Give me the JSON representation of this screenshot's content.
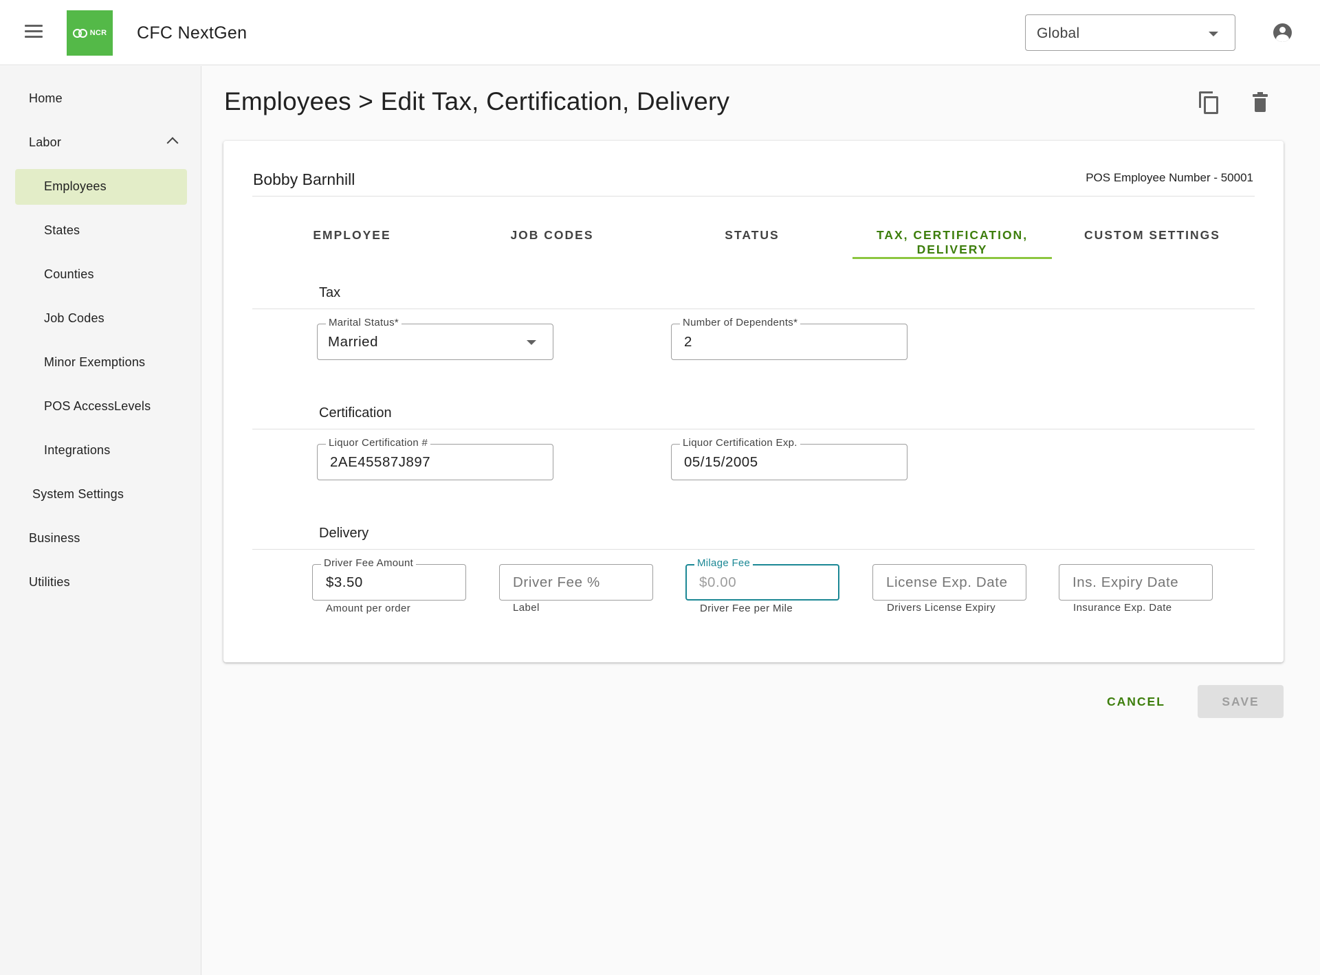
{
  "header": {
    "app_title": "CFC NextGen",
    "logo_text": "NCR",
    "scope_selector": {
      "value": "Global"
    }
  },
  "sidebar": {
    "items": [
      {
        "label": "Home"
      },
      {
        "label": "Labor",
        "expanded": true
      },
      {
        "label": "Employees",
        "active": true
      },
      {
        "label": "States"
      },
      {
        "label": "Counties"
      },
      {
        "label": "Job Codes"
      },
      {
        "label": "Minor Exemptions"
      },
      {
        "label": "POS AccessLevels"
      },
      {
        "label": "Integrations"
      },
      {
        "label": "System Settings"
      },
      {
        "label": "Business"
      },
      {
        "label": "Utilities"
      }
    ]
  },
  "page": {
    "title": "Employees > Edit Tax, Certification, Delivery",
    "actions": [
      "copy-icon",
      "delete-icon"
    ]
  },
  "employee": {
    "name": "Bobby Barnhill",
    "pos_number_text": "POS Employee Number - 50001"
  },
  "tabs": [
    {
      "label": "EMPLOYEE"
    },
    {
      "label": "JOB CODES"
    },
    {
      "label": "STATUS"
    },
    {
      "label": "TAX, CERTIFICATION, DELIVERY",
      "line1": "TAX, CERTIFICATION,",
      "line2": "DELIVERY",
      "active": true
    },
    {
      "label": "CUSTOM SETTINGS"
    }
  ],
  "tax": {
    "title": "Tax",
    "marital_status": {
      "label": "Marital Status*",
      "value": "Married"
    },
    "dependents": {
      "label": "Number of Dependents*",
      "value": "2"
    }
  },
  "certification": {
    "title": "Certification",
    "liquor_cert_number": {
      "label": "Liquor Certification #",
      "value": "2AE45587J897"
    },
    "liquor_cert_exp": {
      "label": "Liquor Certification Exp.",
      "value": "05/15/2005"
    }
  },
  "delivery": {
    "title": "Delivery",
    "driver_fee_amount": {
      "label": "Driver Fee Amount",
      "value": "$3.50",
      "helper": "Amount per order"
    },
    "driver_fee_percent": {
      "placeholder": "Driver Fee %",
      "helper": "Label"
    },
    "milage_fee": {
      "label": "Milage Fee",
      "placeholder": "$0.00",
      "helper": "Driver Fee per Mile",
      "focused": true
    },
    "license_exp": {
      "placeholder": "License Exp. Date",
      "helper": "Drivers License Expiry"
    },
    "insurance_exp": {
      "placeholder": "Ins. Expiry Date",
      "helper": "Insurance Exp. Date"
    }
  },
  "footer": {
    "cancel_label": "CANCEL",
    "save_label": "SAVE",
    "save_disabled": true
  },
  "colors": {
    "brand_green": "#54b948",
    "accent_green": "#3d7e0c",
    "tab_underline": "#8cc63f",
    "active_nav_bg": "#e3edc8",
    "focus_teal": "#1a8794"
  }
}
